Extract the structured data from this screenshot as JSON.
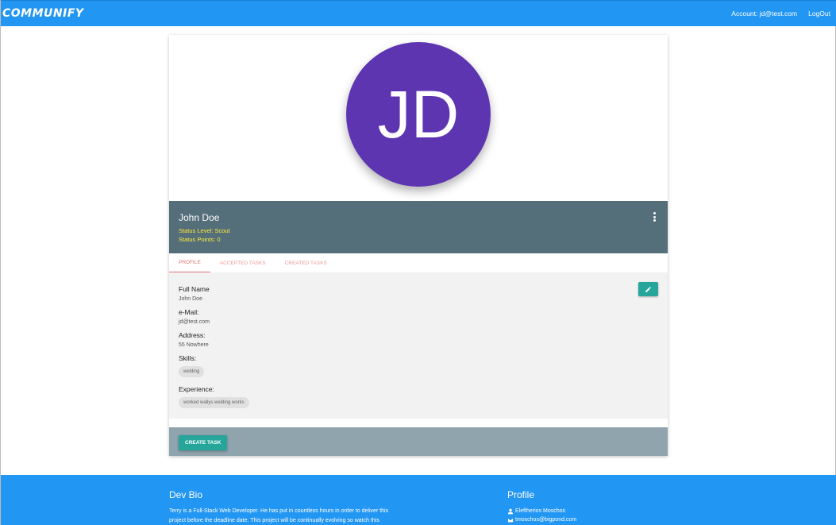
{
  "nav": {
    "brand": "COMMUNIFY",
    "account": "Account: jd@test.com",
    "logout": "LogOut"
  },
  "profile": {
    "initials": "JD",
    "name": "John Doe",
    "status_level": "Status Level: Scout",
    "status_points": "Status Points: 0",
    "avatar_color": "#5e35b1",
    "header_color": "#546e7a"
  },
  "tabs": [
    {
      "label": "PROFILE",
      "active": true
    },
    {
      "label": "ACCEPTED TASKS",
      "active": false
    },
    {
      "label": "CREATED TASKS",
      "active": false
    }
  ],
  "fields": {
    "full_name_label": "Full Name",
    "full_name_value": "John Doe",
    "email_label": "e-Mail:",
    "email_value": "jd@test.com",
    "address_label": "Address:",
    "address_value": "55 Nowhere",
    "skills_label": "Skills:",
    "skills": [
      "welding"
    ],
    "experience_label": "Experience:",
    "experience": [
      "worked wallys welding works"
    ]
  },
  "actions": {
    "create_task": "CREATE TASK",
    "edit_icon": "pencil-icon",
    "accent_color": "#26a69a"
  },
  "footer": {
    "dev_bio_title": "Dev Bio",
    "dev_bio_line1": "Terry is a Full-Stack Web Developer. He has put in countless hours in order to deliver this",
    "dev_bio_line2": "project before the deadline date. This project will be continually evolving so watch this",
    "profile_title": "Profile",
    "profile_name": "Eleftherios Moschos",
    "profile_email": "tmoschos@bigpond.com",
    "primary_color": "#2196f3"
  }
}
